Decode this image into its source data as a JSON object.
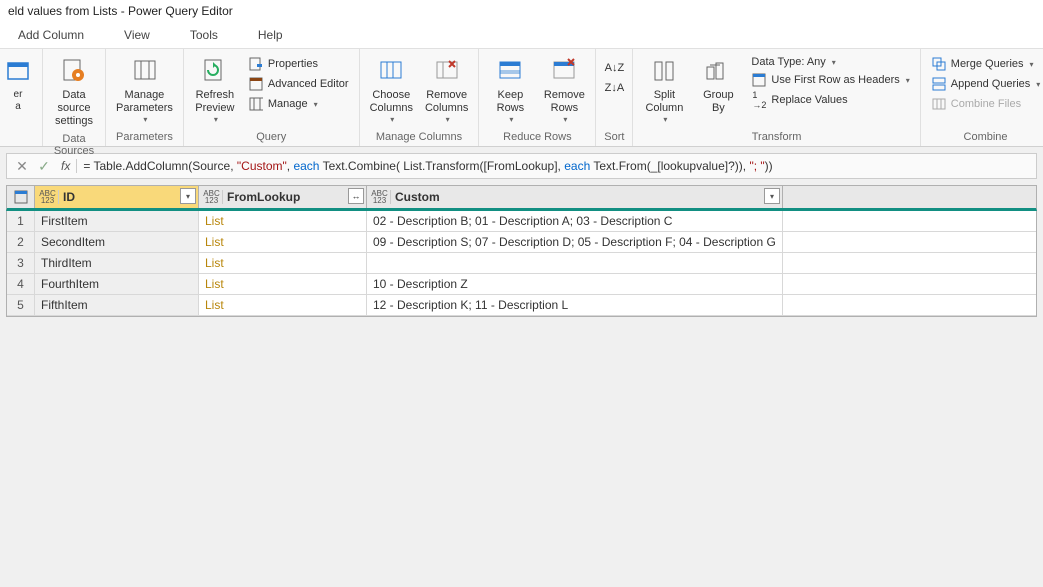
{
  "window": {
    "title": "eld values from Lists - Power Query Editor"
  },
  "tabs": {
    "add_column": "Add Column",
    "view": "View",
    "tools": "Tools",
    "help": "Help"
  },
  "ribbon": {
    "data_sources": {
      "label": "Data Sources",
      "btn": "Data source\nsettings"
    },
    "parameters": {
      "label": "Parameters",
      "btn": "Manage\nParameters"
    },
    "query": {
      "label": "Query",
      "refresh": "Refresh\nPreview",
      "properties": "Properties",
      "advanced": "Advanced Editor",
      "manage": "Manage"
    },
    "manage_cols": {
      "label": "Manage Columns",
      "choose": "Choose\nColumns",
      "remove": "Remove\nColumns"
    },
    "reduce_rows": {
      "label": "Reduce Rows",
      "keep": "Keep\nRows",
      "remove": "Remove\nRows"
    },
    "sort": {
      "label": "Sort"
    },
    "transform": {
      "label": "Transform",
      "split": "Split\nColumn",
      "group": "Group\nBy",
      "datatype": "Data Type: Any",
      "first_row": "Use First Row as Headers",
      "replace": "Replace Values"
    },
    "combine": {
      "label": "Combine",
      "merge": "Merge Queries",
      "append": "Append Queries",
      "files": "Combine Files"
    }
  },
  "formula": {
    "prefix": "= Table.AddColumn(Source, ",
    "str1": "\"Custom\"",
    "mid1": ", ",
    "kw1": "each",
    "mid2": " Text.Combine( List.Transform([FromLookup], ",
    "kw2": "each",
    "mid3": " Text.From(_[lookupvalue]?)), ",
    "str2": "\"; \"",
    "end": "))"
  },
  "grid": {
    "type_tag": "ABC\n123",
    "columns": {
      "id": "ID",
      "from": "FromLookup",
      "custom": "Custom"
    },
    "rows": [
      {
        "n": "1",
        "id": "FirstItem",
        "from": "List",
        "custom": "02 - Description B; 01 - Description A; 03 - Description C"
      },
      {
        "n": "2",
        "id": "SecondItem",
        "from": "List",
        "custom": "09 - Description S; 07 - Description D; 05 - Description F; 04 - Description G"
      },
      {
        "n": "3",
        "id": "ThirdItem",
        "from": "List",
        "custom": ""
      },
      {
        "n": "4",
        "id": "FourthItem",
        "from": "List",
        "custom": "10 - Description Z"
      },
      {
        "n": "5",
        "id": "FifthItem",
        "from": "List",
        "custom": "12 - Description K; 11 - Description L"
      }
    ]
  }
}
